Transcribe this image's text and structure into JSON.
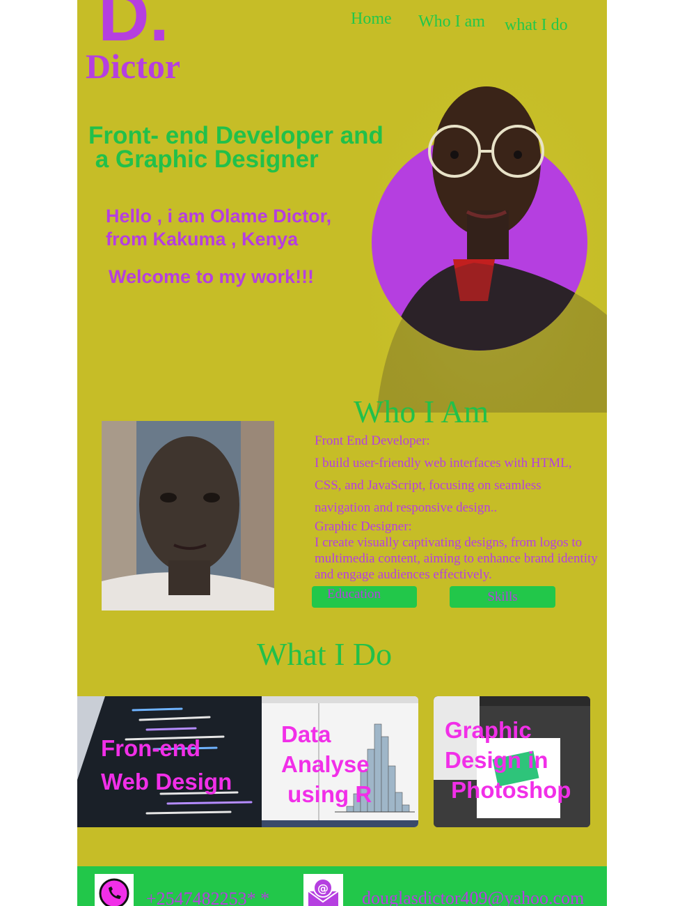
{
  "brand": {
    "mark": "D.",
    "name": "Dictor"
  },
  "nav": {
    "items": [
      "Home",
      "Who I am",
      "what  I do"
    ]
  },
  "hero": {
    "headline_line1": "Front- end Developer and",
    "headline_line2": " a Graphic Designer",
    "greeting_line1": "Hello , i am Olame Dictor,",
    "greeting_line2": "from Kakuma , Kenya",
    "welcome": "Welcome to my work!!!"
  },
  "who": {
    "title": "Who I Am",
    "role1_title": "Front End Developer:",
    "role1_text": "I build user-friendly web interfaces with HTML, CSS, and JavaScript, focusing on seamless navigation and responsive design..",
    "role2_title": "Graphic Designer:",
    "role2_text": "I create visually captivating designs, from logos to multimedia content, aiming to enhance brand identity and engage audiences effectively.",
    "education_button": "Education",
    "skills_button": "Skills"
  },
  "what": {
    "title": "What I Do",
    "cards": [
      {
        "label": "Fron-end\nWeb Design"
      },
      {
        "label": "Data\nAnalyse\n using R"
      },
      {
        "label": "Graphic\nDesign in\n Photoshop"
      }
    ]
  },
  "contact": {
    "phone": "+2547482253* *",
    "email": "douglasdictor409@yahoo.com"
  },
  "colors": {
    "background": "#c6bd27",
    "accent_green": "#22c74a",
    "accent_purple": "#b53fe0",
    "card_label": "#f12fe8"
  },
  "icons": [
    "whatsapp-icon",
    "email-icon"
  ]
}
